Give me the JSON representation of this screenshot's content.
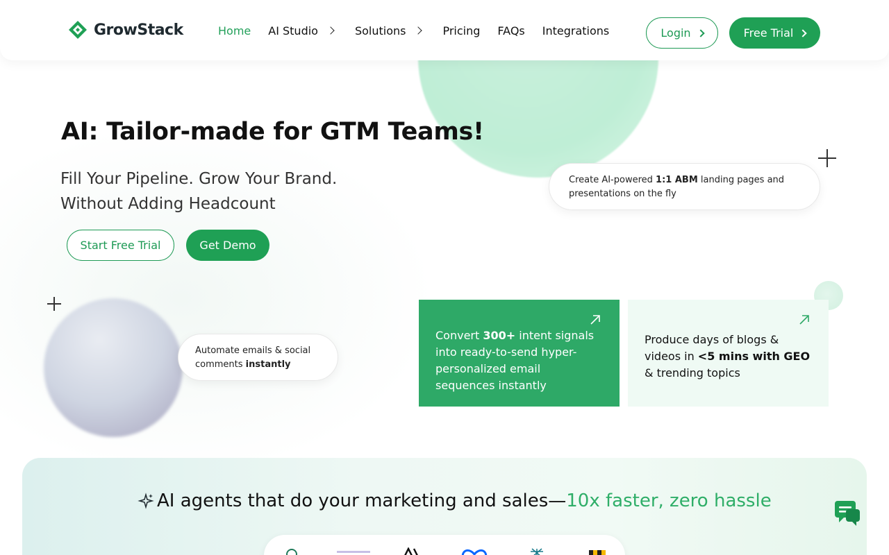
{
  "brand": {
    "name": "GrowStack",
    "accent_color": "#1fa055"
  },
  "nav": {
    "items": [
      {
        "label": "Home",
        "active": true,
        "has_submenu": false
      },
      {
        "label": "AI Studio",
        "active": false,
        "has_submenu": true
      },
      {
        "label": "Solutions",
        "active": false,
        "has_submenu": true
      },
      {
        "label": "Pricing",
        "active": false,
        "has_submenu": false
      },
      {
        "label": "FAQs",
        "active": false,
        "has_submenu": false
      },
      {
        "label": "Integrations",
        "active": false,
        "has_submenu": false
      }
    ],
    "login_label": "Login",
    "free_trial_label": "Free Trial"
  },
  "hero": {
    "title": "AI: Tailor-made for GTM Teams!",
    "subtitle_line1": "Fill Your Pipeline. Grow Your Brand.",
    "subtitle_line2": "Without Adding Headcount",
    "start_trial_label": "Start Free Trial",
    "demo_label": "Get Demo"
  },
  "callouts": {
    "abm": {
      "prefix": "Create AI-powered ",
      "bold": "1:1 ABM",
      "suffix": " landing pages and presentations on the fly"
    },
    "automate": {
      "prefix": "Automate emails & social comments ",
      "bold": "instantly"
    }
  },
  "cards": {
    "email": {
      "prefix": "Convert ",
      "bold": "300+",
      "suffix": " intent signals into ready-to-send hyper-personalized email sequences instantly"
    },
    "content": {
      "prefix": "Produce days of blogs & videos in ",
      "bold": "<5 mins with GEO",
      "suffix": " & trending topics"
    }
  },
  "band": {
    "title_main": "AI agents that do your marketing and sales—",
    "title_highlight": " 10x faster, zero hassle"
  },
  "icons": {
    "logo": "growstack-logo-icon",
    "chat": "chat-icon",
    "sparkle": "sparkle-icon",
    "arrow": "arrow-up-right-icon"
  }
}
